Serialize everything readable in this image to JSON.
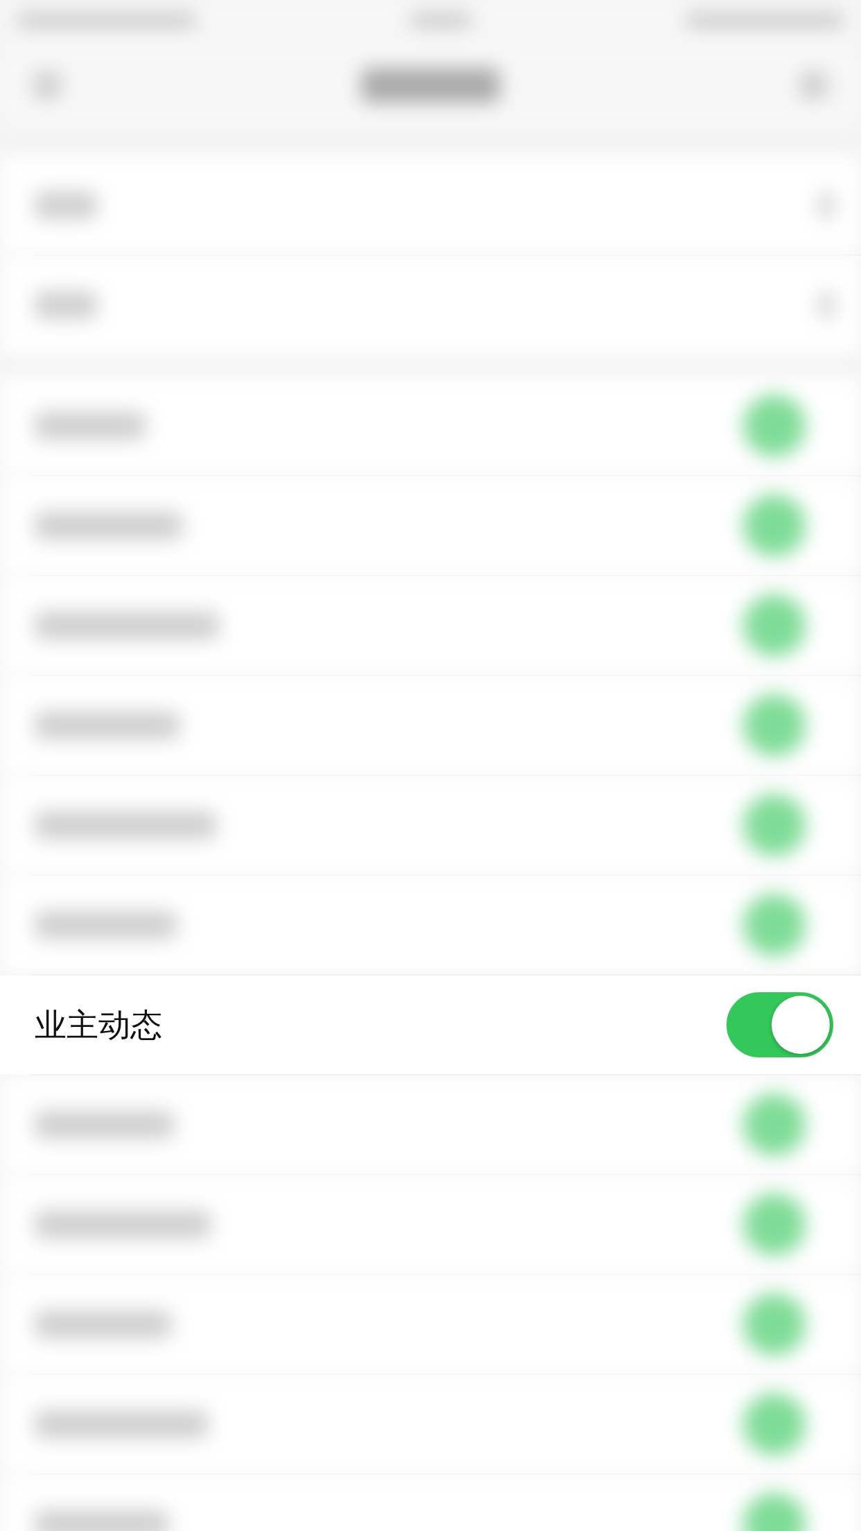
{
  "status_bar": {
    "blurred": true
  },
  "nav_bar": {
    "blurred": true
  },
  "groups": [
    {
      "rows": [
        {
          "kind": "nav",
          "blurred": true
        },
        {
          "kind": "nav",
          "blurred": true
        }
      ]
    },
    {
      "rows": [
        {
          "kind": "toggle",
          "blurred": true,
          "on": true
        },
        {
          "kind": "toggle",
          "blurred": true,
          "on": true
        },
        {
          "kind": "toggle",
          "blurred": true,
          "on": true
        },
        {
          "kind": "toggle",
          "blurred": true,
          "on": true
        },
        {
          "kind": "toggle",
          "blurred": true,
          "on": true
        },
        {
          "kind": "toggle",
          "blurred": true,
          "on": true
        },
        {
          "kind": "toggle",
          "blurred": false,
          "label": "业主动态",
          "on": true
        },
        {
          "kind": "toggle",
          "blurred": true,
          "on": true
        },
        {
          "kind": "toggle",
          "blurred": true,
          "on": true
        },
        {
          "kind": "toggle",
          "blurred": true,
          "on": true
        },
        {
          "kind": "toggle",
          "blurred": true,
          "on": true
        },
        {
          "kind": "toggle",
          "blurred": true,
          "on": true
        }
      ]
    }
  ]
}
